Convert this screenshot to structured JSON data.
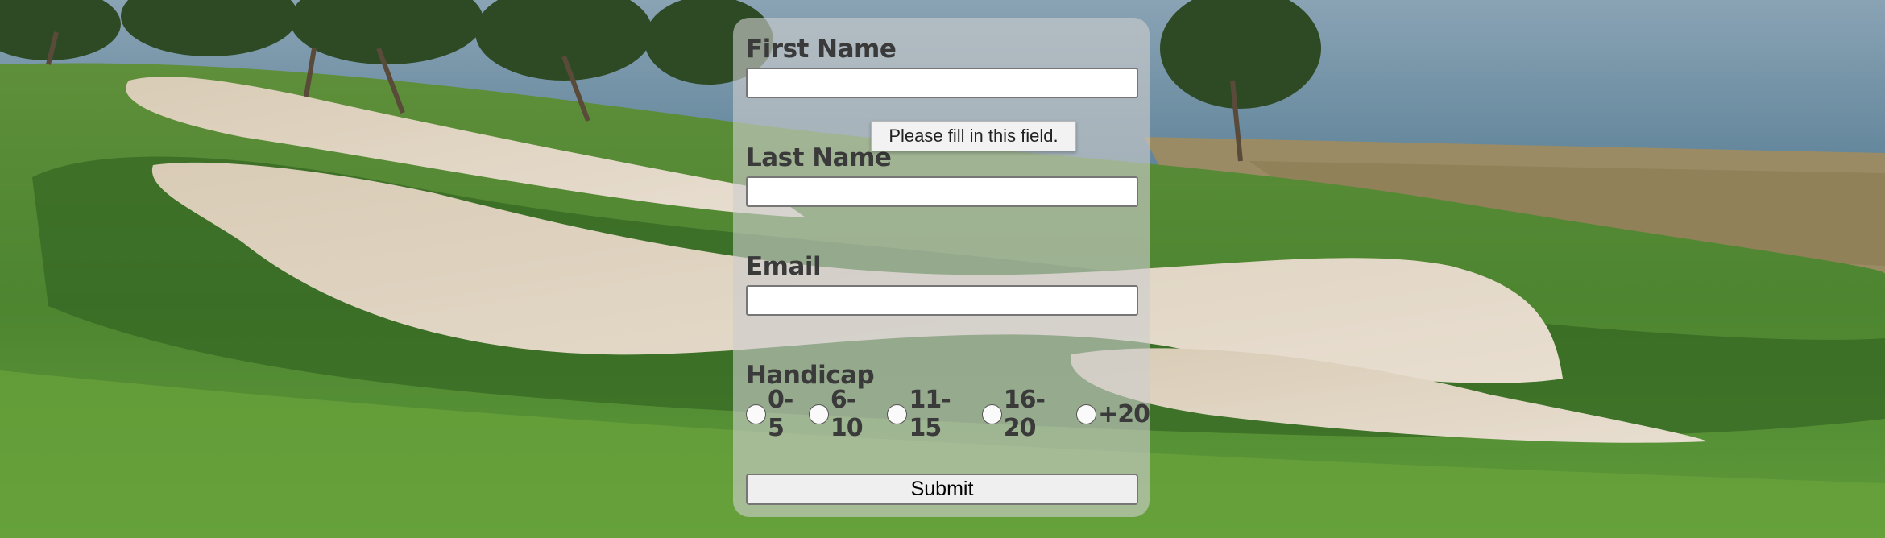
{
  "form": {
    "first_name_label": "First Name",
    "first_name_value": "",
    "last_name_label": "Last Name",
    "last_name_value": "",
    "email_label": "Email",
    "email_value": "",
    "handicap_label": "Handicap",
    "handicap_options": [
      "0-5",
      "6-10",
      "11-15",
      "16-20",
      "+20"
    ],
    "submit_label": "Submit"
  },
  "tooltip": {
    "message": "Please fill in this field."
  },
  "colors": {
    "panel": "#cdcdcd",
    "label_text": "#3a3a3a",
    "grass": "#3f7a2c",
    "sand": "#e3d8c4",
    "ocean": "#6f8fa4"
  }
}
